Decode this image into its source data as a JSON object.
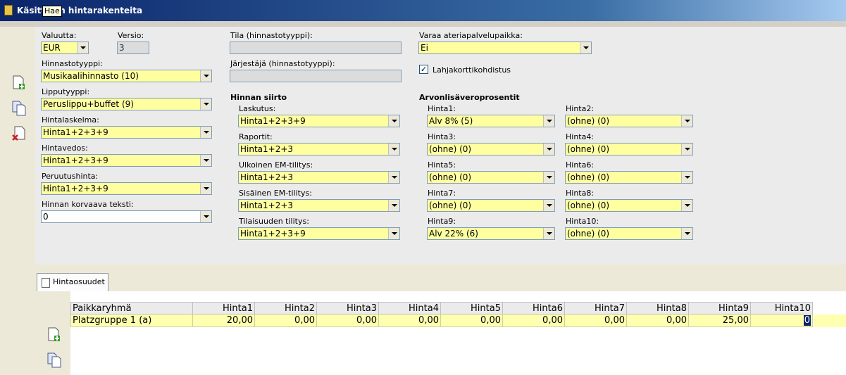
{
  "window": {
    "title": "Käsittelyn hintarakenteita",
    "tooltip": "Hae"
  },
  "left": {
    "valuutta": {
      "label": "Valuutta:",
      "value": "EUR"
    },
    "versio": {
      "label": "Versio:",
      "value": "3"
    },
    "hinnastotyyppi": {
      "label": "Hinnastotyyppi:",
      "value": "Musikaalihinnasto (10)"
    },
    "lipputyyppi": {
      "label": "Lipputyyppi:",
      "value": "Peruslippu+buffet (9)"
    },
    "hintalaskelma": {
      "label": "Hintalaskelma:",
      "value": "Hinta1+2+3+9"
    },
    "hintavedos": {
      "label": "Hintavedos:",
      "value": "Hinta1+2+3+9"
    },
    "peruutushinta": {
      "label": "Peruutushinta:",
      "value": "Hinta1+2+3+9"
    },
    "korvaava": {
      "label": "Hinnan korvaava teksti:",
      "value": "0"
    }
  },
  "middle": {
    "tila": {
      "label": "Tila (hinnastotyyppi):",
      "value": ""
    },
    "jarjestaja": {
      "label": "Järjestäjä (hinnastotyyppi):",
      "value": ""
    },
    "siirto_header": "Hinnan siirto",
    "laskutus": {
      "label": "Laskutus:",
      "value": "Hinta1+2+3+9"
    },
    "raportit": {
      "label": "Raportit:",
      "value": "Hinta1+2+3"
    },
    "ulkoinen": {
      "label": "Ulkoinen EM-tilitys:",
      "value": "Hinta1+2+3"
    },
    "sisainen": {
      "label": "Sisäinen EM-tilitys:",
      "value": "Hinta1+2+3"
    },
    "tilaisuuden": {
      "label": "Tilaisuuden tilitys:",
      "value": "Hinta1+2+3+9"
    }
  },
  "right": {
    "varaa": {
      "label": "Varaa ateriapalvelupaikka:",
      "value": "Ei"
    },
    "lahjakortti": {
      "label": "Lahjakorttikohdistus",
      "checked": "✓"
    },
    "alv_header": "Arvonlisäveroprosentit",
    "hinnat": [
      {
        "label": "Hinta1:",
        "value": "Alv 8% (5)"
      },
      {
        "label": "Hinta2:",
        "value": "(ohne) (0)"
      },
      {
        "label": "Hinta3:",
        "value": "(ohne) (0)"
      },
      {
        "label": "Hinta4:",
        "value": "(ohne) (0)"
      },
      {
        "label": "Hinta5:",
        "value": "(ohne) (0)"
      },
      {
        "label": "Hinta6:",
        "value": "(ohne) (0)"
      },
      {
        "label": "Hinta7:",
        "value": "(ohne) (0)"
      },
      {
        "label": "Hinta8:",
        "value": "(ohne) (0)"
      },
      {
        "label": "Hinta9:",
        "value": "Alv 22% (6)"
      },
      {
        "label": "Hinta10:",
        "value": "(ohne) (0)"
      }
    ]
  },
  "tab": {
    "label": "Hintaosuudet"
  },
  "grid": {
    "columns": [
      "Paikkaryhmä",
      "Hinta1",
      "Hinta2",
      "Hinta3",
      "Hinta4",
      "Hinta5",
      "Hinta6",
      "Hinta7",
      "Hinta8",
      "Hinta9",
      "Hinta10"
    ],
    "rows": [
      [
        "Platzgruppe 1 (a)",
        "20,00",
        "0,00",
        "0,00",
        "0,00",
        "0,00",
        "0,00",
        "0,00",
        "0,00",
        "25,00",
        "0"
      ]
    ]
  },
  "icons": {
    "add": "add-document-icon",
    "copy": "copy-document-icon",
    "delete": "delete-document-icon"
  }
}
